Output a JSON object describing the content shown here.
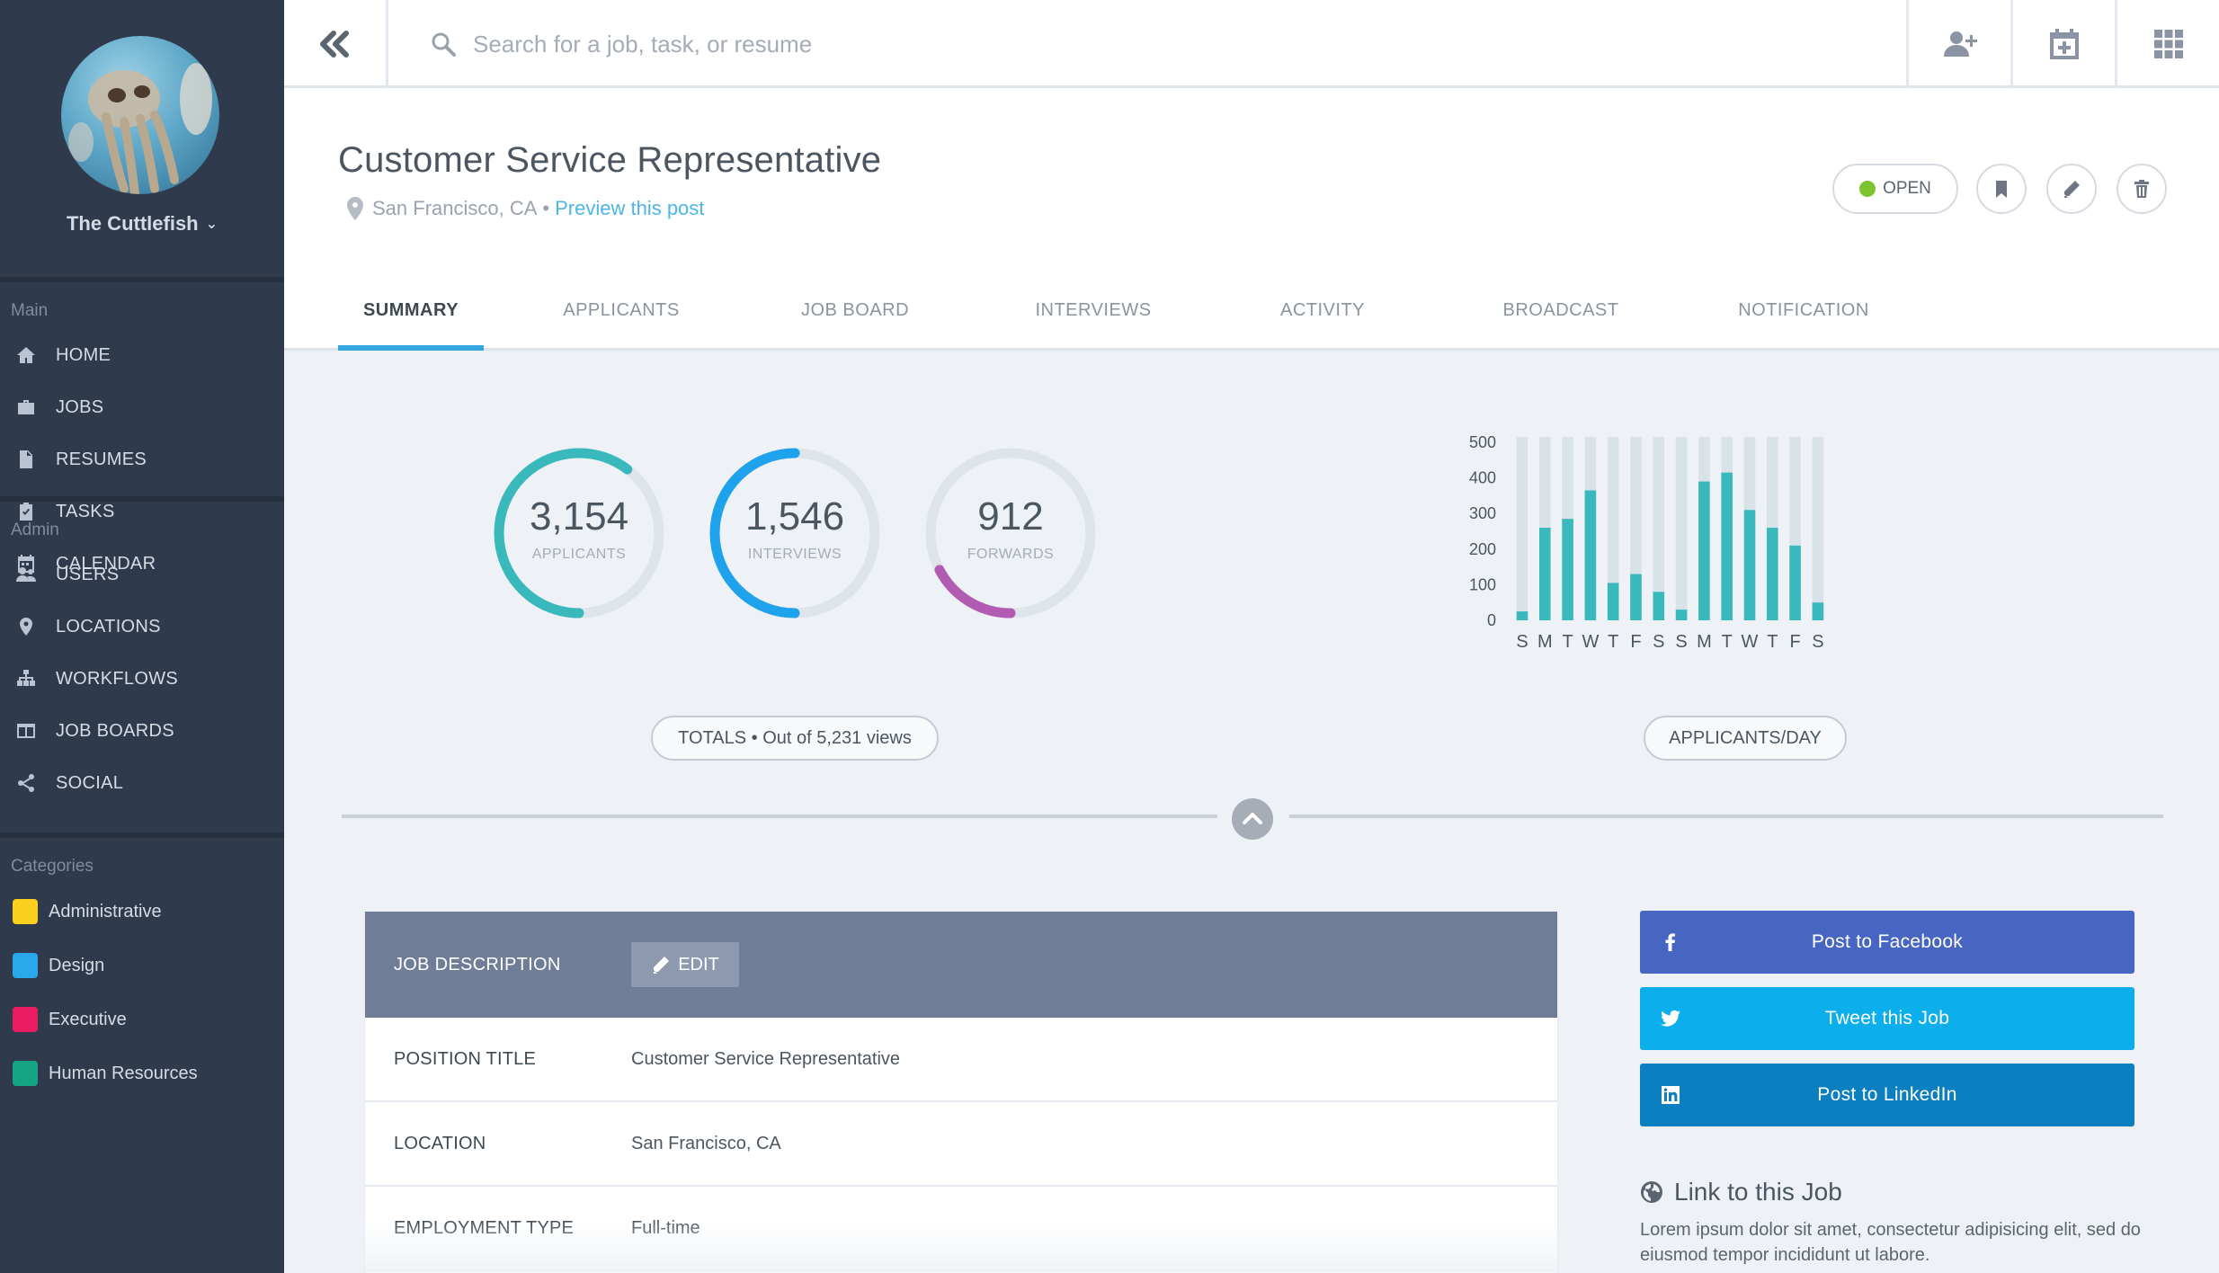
{
  "sidebar": {
    "profile_name": "The Cuttlefish",
    "sections": [
      {
        "heading": "Main",
        "items": [
          {
            "label": "HOME",
            "icon": "home-icon"
          },
          {
            "label": "JOBS",
            "icon": "briefcase-icon"
          },
          {
            "label": "RESUMES",
            "icon": "document-icon"
          },
          {
            "label": "TASKS",
            "icon": "clipboard-check-icon"
          },
          {
            "label": "CALENDAR",
            "icon": "calendar-icon"
          }
        ]
      },
      {
        "heading": "Admin",
        "items": [
          {
            "label": "USERS",
            "icon": "users-icon"
          },
          {
            "label": "LOCATIONS",
            "icon": "map-pin-icon"
          },
          {
            "label": "WORKFLOWS",
            "icon": "sitemap-icon"
          },
          {
            "label": "JOB BOARDS",
            "icon": "columns-icon"
          },
          {
            "label": "SOCIAL",
            "icon": "share-icon"
          }
        ]
      }
    ],
    "categories_heading": "Categories",
    "categories": [
      {
        "label": "Administrative",
        "color": "#f9d01e"
      },
      {
        "label": "Design",
        "color": "#29a8ec"
      },
      {
        "label": "Executive",
        "color": "#ea1d63"
      },
      {
        "label": "Human Resources",
        "color": "#15a585"
      }
    ]
  },
  "topbar": {
    "search_placeholder": "Search for a job, task, or resume",
    "icons": [
      "add-user-icon",
      "calendar-plus-icon",
      "grid-icon"
    ]
  },
  "job": {
    "title": "Customer Service Representative",
    "location": "San Francisco, CA",
    "separator": "•",
    "preview_link": "Preview this post",
    "status": "OPEN",
    "status_color": "#7bc42f"
  },
  "tabs": [
    "SUMMARY",
    "APPLICANTS",
    "JOB BOARD",
    "INTERVIEWS",
    "ACTIVITY",
    "BROADCAST",
    "NOTIFICATION"
  ],
  "totals": {
    "applicants": {
      "value": "3,154",
      "label": "APPLICANTS",
      "fraction": 0.603,
      "color": "#3ab9bd"
    },
    "interviews": {
      "value": "1,546",
      "label": "INTERVIEWS",
      "fraction": 0.5,
      "color": "#1fa2ec"
    },
    "forwards": {
      "value": "912",
      "label": "FORWARDS",
      "fraction": 0.174,
      "color": "#b25bb2"
    },
    "caption": "TOTALS • Out of 5,231 views"
  },
  "chart_data": {
    "type": "bar",
    "categories": [
      "S",
      "M",
      "T",
      "W",
      "T",
      "F",
      "S",
      "S",
      "M",
      "T",
      "W",
      "T",
      "F",
      "S"
    ],
    "values": [
      25,
      260,
      285,
      365,
      105,
      130,
      80,
      30,
      390,
      415,
      310,
      260,
      210,
      50
    ],
    "ylim": [
      0,
      500
    ],
    "yticks": [
      500,
      400,
      300,
      200,
      100,
      0
    ],
    "bar_color": "#3ab9bd",
    "track_color": "#d9e2e8",
    "caption": "APPLICANTS/DAY"
  },
  "description": {
    "header_label": "JOB DESCRIPTION",
    "edit_label": "EDIT",
    "rows": [
      {
        "key": "POSITION TITLE",
        "value": "Customer Service Representative"
      },
      {
        "key": "LOCATION",
        "value": "San Francisco, CA"
      },
      {
        "key": "EMPLOYMENT TYPE",
        "value": "Full-time"
      }
    ]
  },
  "social": {
    "facebook": {
      "label": "Post to Facebook",
      "color": "#4766c2"
    },
    "twitter": {
      "label": "Tweet this Job",
      "color": "#0cafec"
    },
    "linkedin": {
      "label": "Post to LinkedIn",
      "color": "#0b7fbf"
    }
  },
  "link_section": {
    "title": "Link to this Job",
    "body": "Lorem ipsum dolor sit amet, consectetur adipisicing elit, sed do eiusmod tempor incididunt ut labore."
  }
}
